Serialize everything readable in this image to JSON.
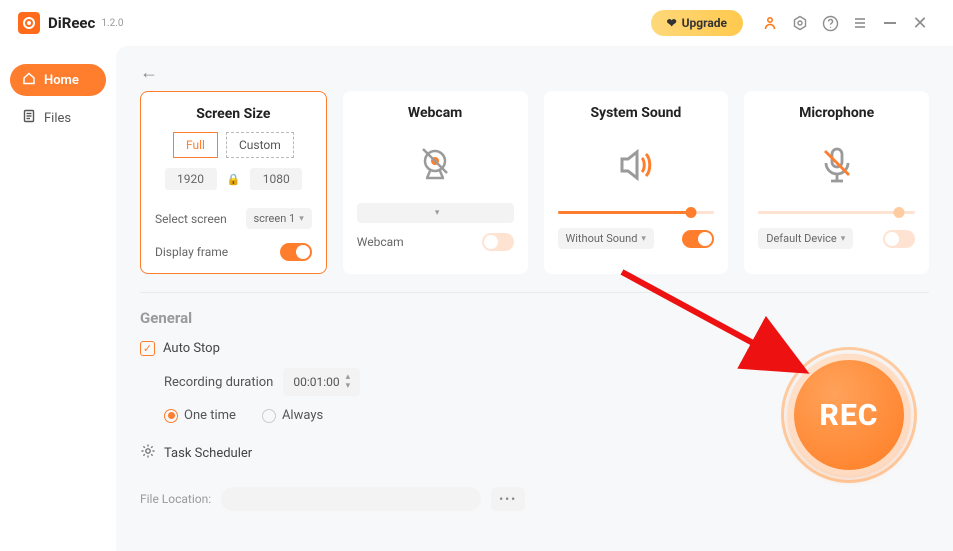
{
  "app": {
    "name": "DiReec",
    "version": "1.2.0"
  },
  "topbar": {
    "upgrade_label": "Upgrade"
  },
  "sidebar": {
    "items": [
      {
        "label": "Home",
        "active": true
      },
      {
        "label": "Files",
        "active": false
      }
    ]
  },
  "cards": {
    "screen": {
      "title": "Screen Size",
      "full_label": "Full",
      "custom_label": "Custom",
      "width": "1920",
      "height": "1080",
      "select_label": "Select screen",
      "select_value": "screen 1",
      "display_frame_label": "Display frame",
      "display_frame_on": true
    },
    "webcam": {
      "title": "Webcam",
      "dropdown_value": "",
      "bottom_label": "Webcam",
      "toggle_on": false
    },
    "sound": {
      "title": "System Sound",
      "dropdown_value": "Without Sound",
      "slider_pct": 85,
      "toggle_on": true
    },
    "mic": {
      "title": "Microphone",
      "dropdown_value": "Default Device",
      "slider_pct": 90,
      "toggle_on": false
    }
  },
  "general": {
    "heading": "General",
    "auto_stop_label": "Auto Stop",
    "auto_stop_checked": true,
    "duration_label": "Recording duration",
    "duration_value": "00:01:00",
    "one_time_label": "One time",
    "always_label": "Always",
    "task_scheduler_label": "Task Scheduler",
    "file_location_label": "File Location:"
  },
  "rec": {
    "label": "REC"
  }
}
